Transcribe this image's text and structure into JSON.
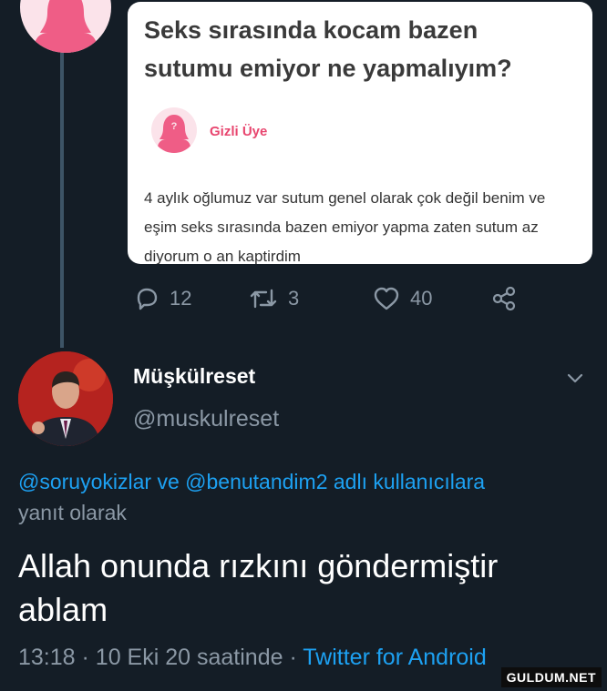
{
  "question_card": {
    "title": "Seks sırasında kocam bazen sutumu emiyor ne yapmalıyım?",
    "member_name": "Gizli Üye",
    "body": "4 aylık oğlumuz var sutum genel olarak çok değil benim ve eşim seks sırasında bazen emiyor yapma zaten sutum az diyorum o an kaptirdim"
  },
  "quoted_actions": {
    "replies": "12",
    "retweets": "3",
    "likes": "40"
  },
  "reply": {
    "display_name": "Müşkülreset",
    "handle": "@muskulreset",
    "mention_1": "@soruyokizlar",
    "connector": "ve",
    "mention_2": "@benutandim2",
    "reply_suffix": "adlı kullanıcılara",
    "reply_line_2": "yanıt olarak",
    "text": "Allah onunda rızkını göndermiştir ablam",
    "time": "13:18",
    "date": "10 Eki 20 saatinde",
    "separator": "·",
    "source": "Twitter for Android"
  },
  "watermark": "GULDUM.NET",
  "colors": {
    "background": "#141d26",
    "accent": "#1da1f2",
    "secondary_text": "#8b98a5",
    "member_pink": "#e8466f"
  },
  "icons": [
    "anonymous-woman-icon",
    "reply-icon",
    "retweet-icon",
    "heart-icon",
    "share-icon",
    "chevron-down-icon"
  ]
}
